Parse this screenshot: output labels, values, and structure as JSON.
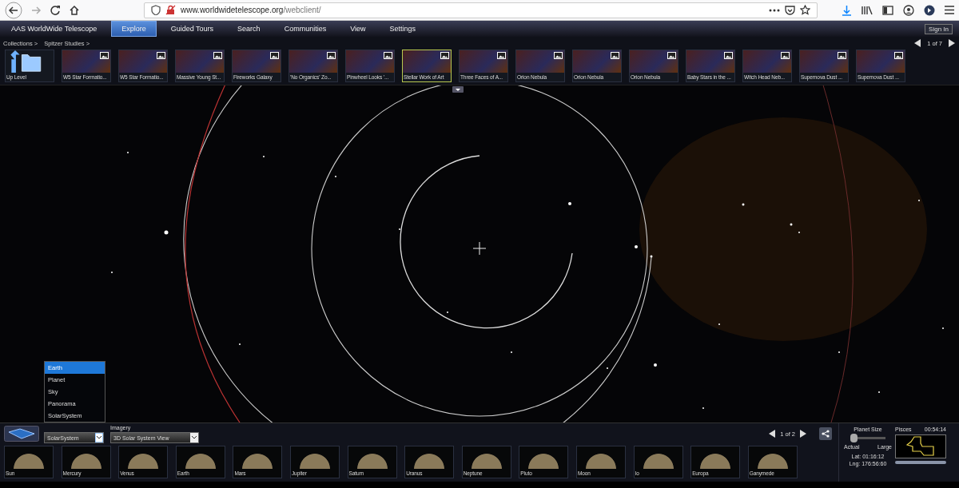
{
  "browser": {
    "url_host": "www.worldwidetelescope.org",
    "url_path": "/webclient/"
  },
  "menu": {
    "brand": "AAS WorldWide Telescope",
    "items": [
      {
        "label": "Explore",
        "selected": true
      },
      {
        "label": "Guided Tours",
        "selected": false
      },
      {
        "label": "Search",
        "selected": false
      },
      {
        "label": "Communities",
        "selected": false
      },
      {
        "label": "View",
        "selected": false
      },
      {
        "label": "Settings",
        "selected": false
      }
    ],
    "sign_in": "Sign In"
  },
  "breadcrumb": [
    "Collections >",
    "Spitzer Studies >"
  ],
  "collection_pager": "1 of 7",
  "collection": [
    {
      "label": "Up Level",
      "kind": "folder",
      "selected": false
    },
    {
      "label": "W5 Star Formatio...",
      "kind": "image",
      "selected": false
    },
    {
      "label": "W5 Star Formatio...",
      "kind": "image",
      "selected": false
    },
    {
      "label": "Massive Young St...",
      "kind": "image",
      "selected": false
    },
    {
      "label": "Fireworks Galaxy",
      "kind": "image",
      "selected": false
    },
    {
      "label": "'No Organics' Zo...",
      "kind": "image",
      "selected": false
    },
    {
      "label": "Pinwheel Looks '...",
      "kind": "image",
      "selected": false
    },
    {
      "label": "Stellar Work of Art",
      "kind": "image",
      "selected": true
    },
    {
      "label": "Three Faces of A...",
      "kind": "image",
      "selected": false
    },
    {
      "label": "Orion Nebula",
      "kind": "image",
      "selected": false
    },
    {
      "label": "Orion Nebula",
      "kind": "image",
      "selected": false
    },
    {
      "label": "Orion Nebula",
      "kind": "image",
      "selected": false
    },
    {
      "label": "Baby Stars in the ...",
      "kind": "image",
      "selected": false
    },
    {
      "label": "Witch Head Neb...",
      "kind": "image",
      "selected": false
    },
    {
      "label": "Supernova Dust ...",
      "kind": "image",
      "selected": false
    },
    {
      "label": "Supernova Dust ...",
      "kind": "image",
      "selected": false
    }
  ],
  "mode_dropdown": {
    "value": "SolarSystem",
    "options": [
      {
        "label": "Earth",
        "highlighted": true
      },
      {
        "label": "Planet",
        "highlighted": false
      },
      {
        "label": "Sky",
        "highlighted": false
      },
      {
        "label": "Panorama",
        "highlighted": false
      },
      {
        "label": "SolarSystem",
        "highlighted": false
      }
    ]
  },
  "imagery": {
    "label": "Imagery",
    "value": "3D Solar System View"
  },
  "planet_pager": "1 of 2",
  "planets": [
    {
      "label": "Sun"
    },
    {
      "label": "Mercury"
    },
    {
      "label": "Venus"
    },
    {
      "label": "Earth"
    },
    {
      "label": "Mars"
    },
    {
      "label": "Jupiter"
    },
    {
      "label": "Saturn"
    },
    {
      "label": "Uranus"
    },
    {
      "label": "Neptune"
    },
    {
      "label": "Pluto"
    },
    {
      "label": "Moon"
    },
    {
      "label": "Io"
    },
    {
      "label": "Europa"
    },
    {
      "label": "Ganymede"
    }
  ],
  "planet_size": {
    "label": "Planet Size",
    "level": 0,
    "min_label": "Actual",
    "max_label": "Large"
  },
  "constellation": {
    "name": "Pisces",
    "time": "00:54:14"
  },
  "coordinates": {
    "lat": "Lat: 01:16:12",
    "lng": "Lng: 176:56:60"
  }
}
